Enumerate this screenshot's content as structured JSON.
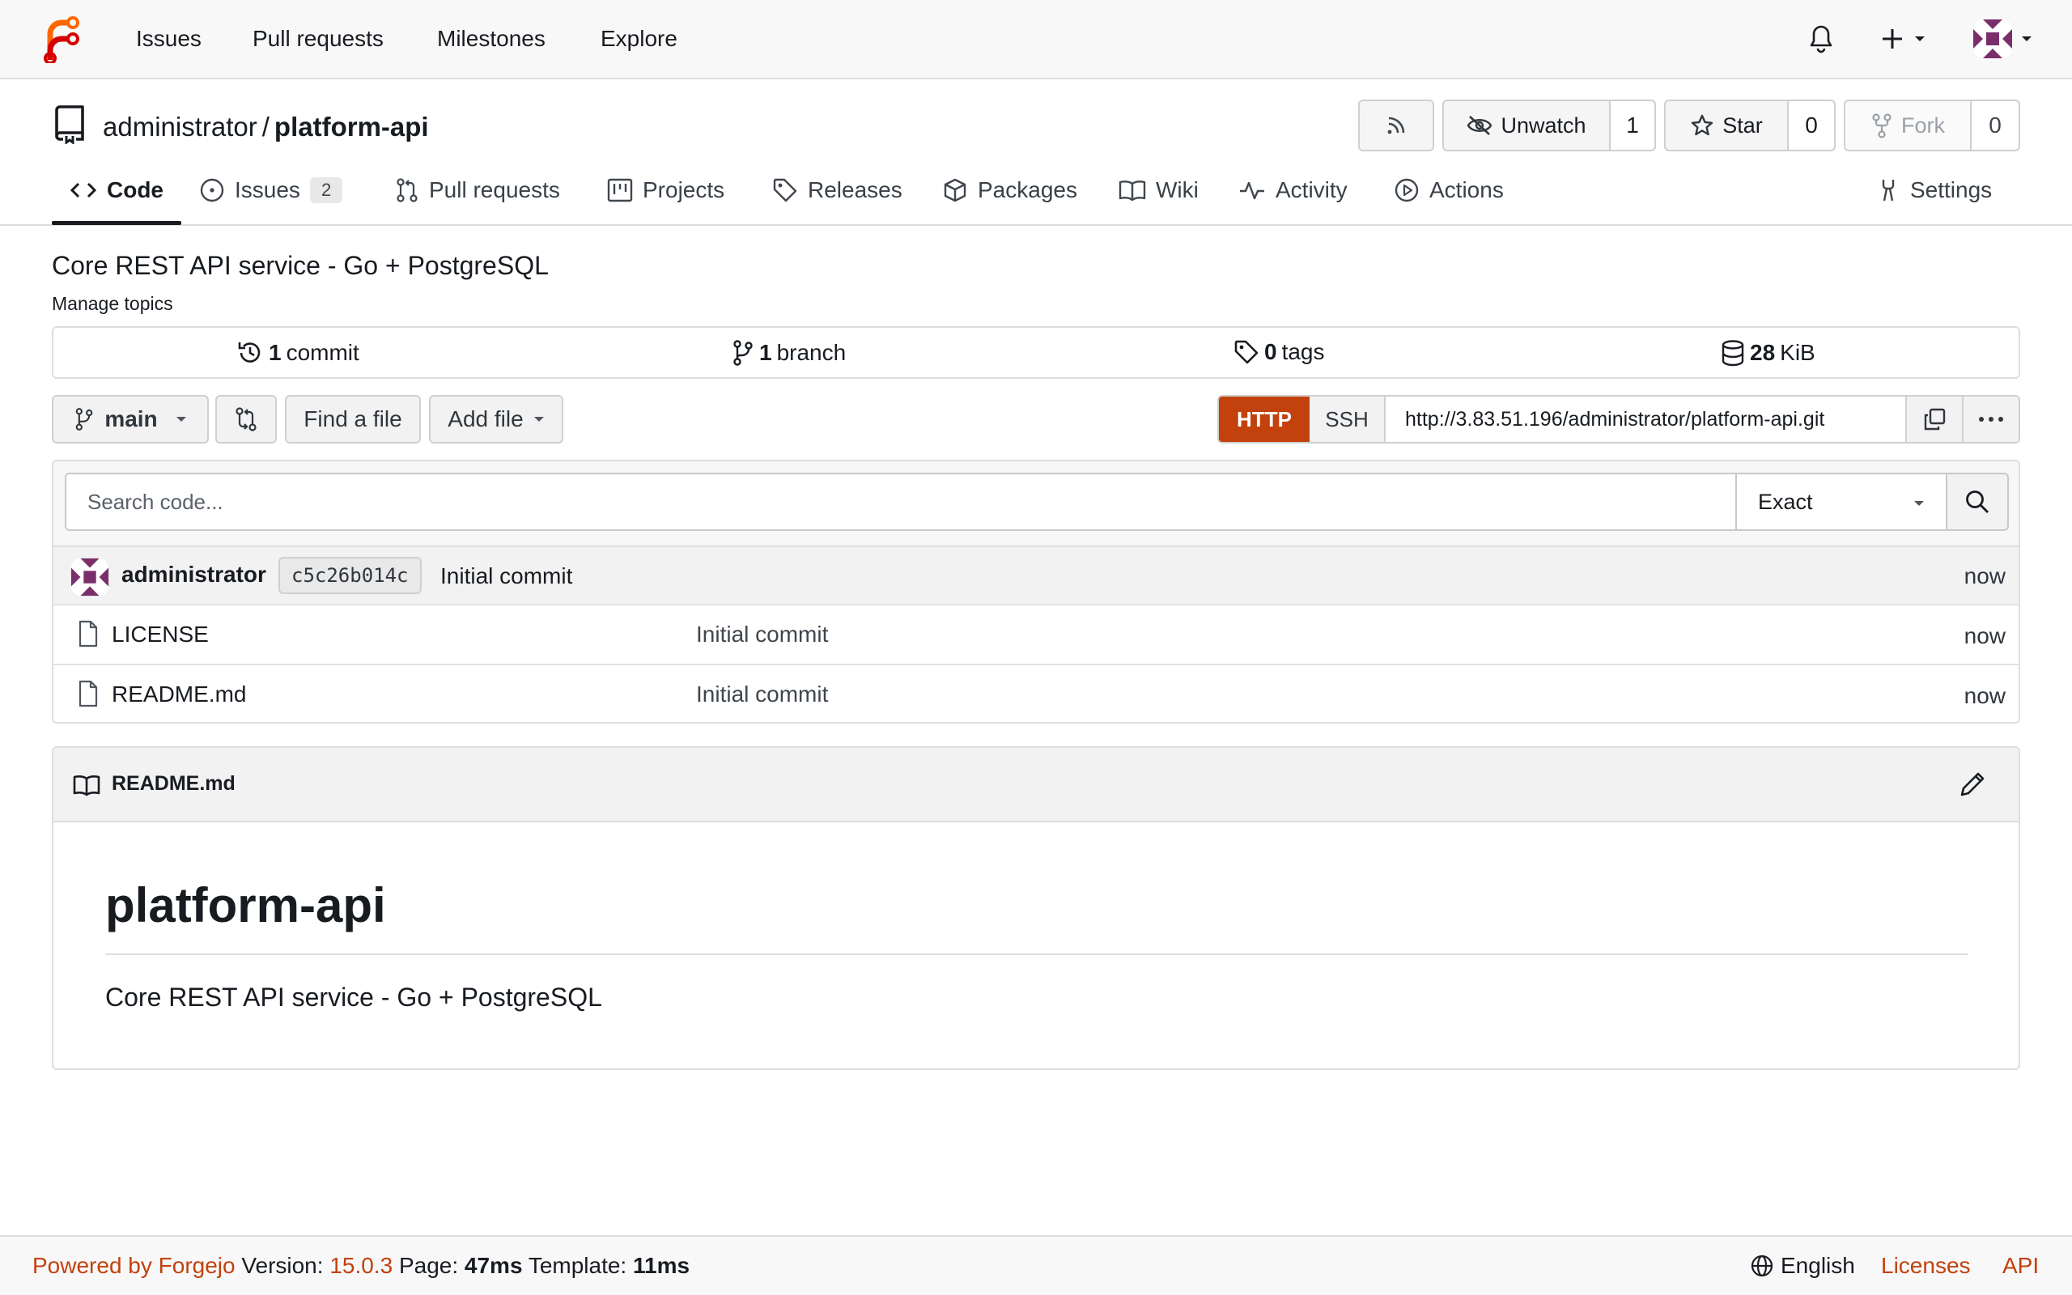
{
  "nav": {
    "links": [
      "Issues",
      "Pull requests",
      "Milestones",
      "Explore"
    ]
  },
  "repo": {
    "owner": "administrator",
    "separator": "/",
    "name": "platform-api",
    "watch_label": "Unwatch",
    "watch_count": "1",
    "star_label": "Star",
    "star_count": "0",
    "fork_label": "Fork",
    "fork_count": "0"
  },
  "tabs": {
    "code": "Code",
    "issues": "Issues",
    "issues_count": "2",
    "pulls": "Pull requests",
    "projects": "Projects",
    "releases": "Releases",
    "packages": "Packages",
    "wiki": "Wiki",
    "activity": "Activity",
    "actions": "Actions",
    "settings": "Settings"
  },
  "description": "Core REST API service - Go + PostgreSQL",
  "topics_link": "Manage topics",
  "stats": {
    "commits_num": "1",
    "commits_label": "commit",
    "branches_num": "1",
    "branches_label": "branch",
    "tags_num": "0",
    "tags_label": "tags",
    "size_num": "28",
    "size_unit": "KiB"
  },
  "toolbar": {
    "branch": "main",
    "find_file": "Find a file",
    "add_file": "Add file",
    "http": "HTTP",
    "ssh": "SSH",
    "clone_url": "http://3.83.51.196/administrator/platform-api.git"
  },
  "search": {
    "placeholder": "Search code...",
    "mode": "Exact"
  },
  "latest_commit": {
    "author": "administrator",
    "sha": "c5c26b014c",
    "message": "Initial commit",
    "time": "now"
  },
  "files": [
    {
      "name": "LICENSE",
      "message": "Initial commit",
      "time": "now"
    },
    {
      "name": "README.md",
      "message": "Initial commit",
      "time": "now"
    }
  ],
  "readme": {
    "filename": "README.md",
    "heading": "platform-api",
    "body": "Core REST API service - Go + PostgreSQL"
  },
  "footer": {
    "powered": "Powered by Forgejo",
    "version_label": "Version:",
    "version": "15.0.3",
    "page_label": "Page:",
    "page_time": "47ms",
    "template_label": "Template:",
    "template_time": "11ms",
    "language": "English",
    "licenses": "Licenses",
    "api": "API"
  },
  "colors": {
    "accent": "#c2410c",
    "text": "#181c21"
  }
}
